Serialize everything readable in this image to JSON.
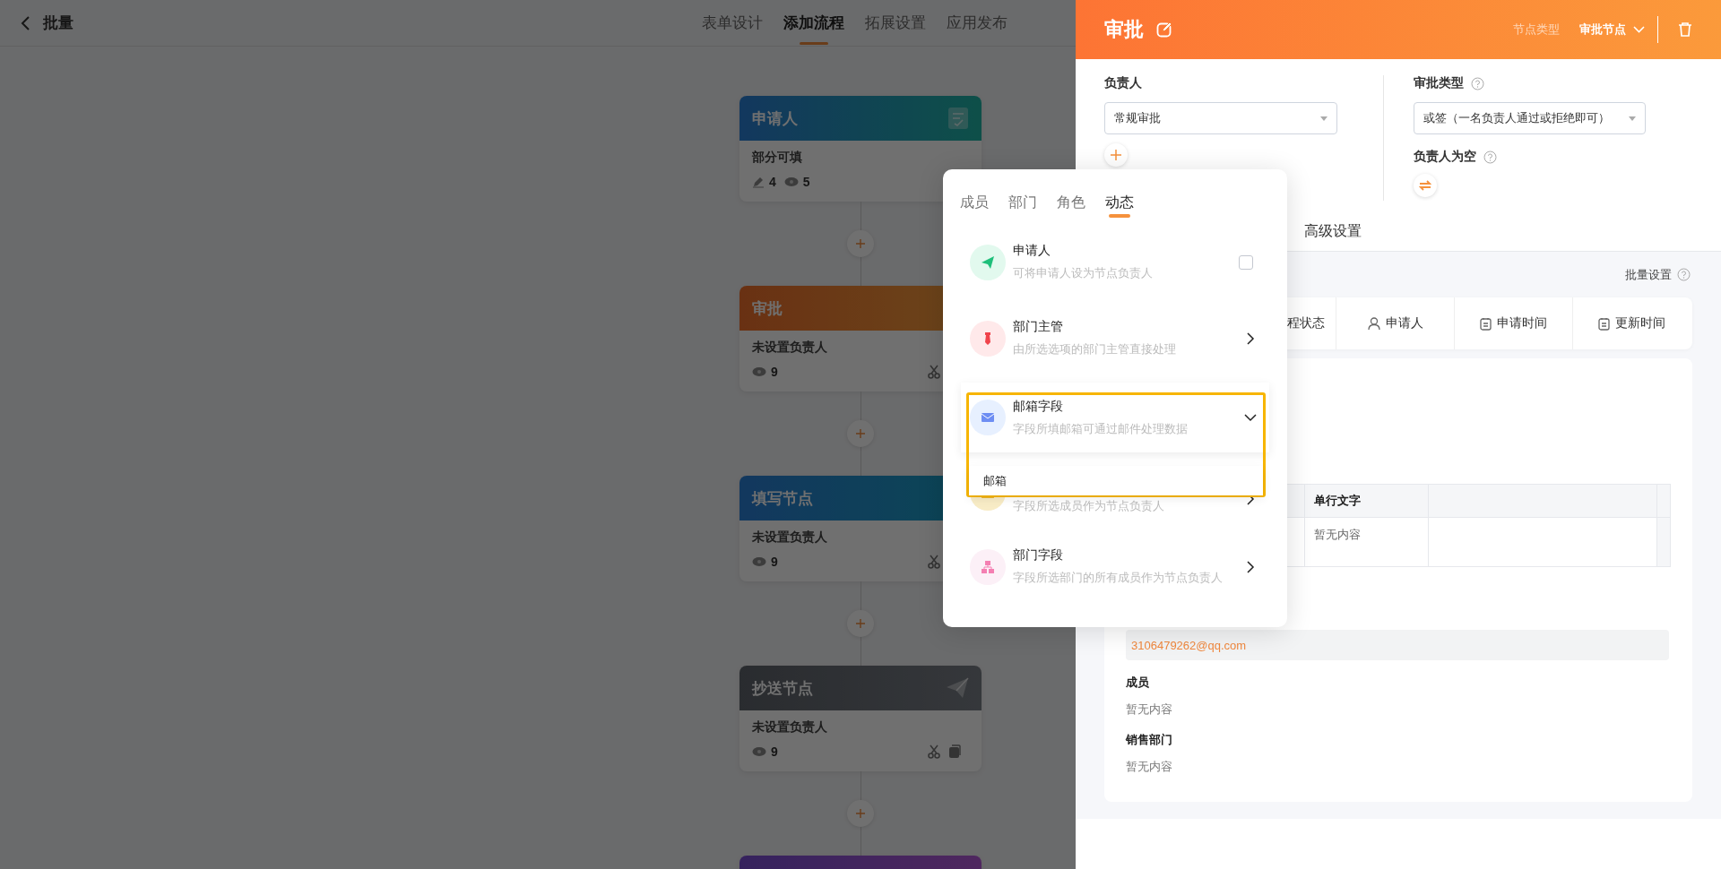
{
  "header": {
    "title": "批量",
    "tabs": [
      {
        "label": "表单设计",
        "selected": false
      },
      {
        "label": "添加流程",
        "selected": true
      },
      {
        "label": "拓展设置",
        "selected": false
      },
      {
        "label": "应用发布",
        "selected": false
      }
    ]
  },
  "flow": {
    "nodes": [
      {
        "kind": "start",
        "title": "申请人",
        "summary": "部分可填",
        "stats": [
          {
            "kind": "edit",
            "count": "4"
          },
          {
            "kind": "view",
            "count": "5"
          }
        ]
      },
      {
        "kind": "approval",
        "title": "审批",
        "summary": "未设置负责人",
        "stats": [
          {
            "kind": "view",
            "count": "9"
          }
        ],
        "actions": [
          {
            "kind": "cut"
          }
        ]
      },
      {
        "kind": "fill",
        "title": "填写节点",
        "summary": "未设置负责人",
        "stats": [
          {
            "kind": "view",
            "count": "9"
          }
        ],
        "actions": [
          {
            "kind": "cut"
          }
        ]
      },
      {
        "kind": "cc",
        "title": "抄送节点",
        "summary": "未设置负责人",
        "stats": [
          {
            "kind": "view",
            "count": "9"
          }
        ],
        "actions": [
          {
            "kind": "cut"
          },
          {
            "kind": "copy"
          }
        ]
      },
      {
        "kind": "other"
      }
    ]
  },
  "panel": {
    "title": "审批",
    "node_type_label": "节点类型",
    "node_type": "审批节点",
    "owner": {
      "label": "负责人",
      "value": "常规审批"
    },
    "approval_type": {
      "label": "审批类型",
      "value": "或签（一名负责人通过或拒绝即可）"
    },
    "empty_owner": {
      "label": "负责人为空"
    },
    "tabs": [
      {
        "label": "高级设置",
        "selected": false
      }
    ],
    "batch_label": "批量设置",
    "toolbar": [
      {
        "kind": "status",
        "label": "程状态"
      },
      {
        "kind": "person",
        "label": "申请人"
      },
      {
        "kind": "date",
        "label": "申请时间"
      },
      {
        "kind": "date",
        "label": "更新时间"
      }
    ],
    "table": {
      "columns": [
        "单行文字"
      ],
      "rows": [
        [
          "暂无内容"
        ]
      ]
    },
    "email": "3106479262@qq.com",
    "sections": [
      {
        "label": "成员",
        "value": "暂无内容"
      },
      {
        "label": "销售部门",
        "value": "暂无内容"
      }
    ]
  },
  "picker": {
    "tabs": [
      {
        "label": "成员",
        "selected": false
      },
      {
        "label": "部门",
        "selected": false
      },
      {
        "label": "角色",
        "selected": false
      },
      {
        "label": "动态",
        "selected": true
      }
    ],
    "items": [
      {
        "kind": "check",
        "title": "申请人",
        "desc": "可将申请人设为节点负责人",
        "checked": false
      },
      {
        "kind": "menu",
        "title": "部门主管",
        "desc": "由所选选项的部门主管直接处理",
        "expanded": false
      },
      {
        "kind": "menu",
        "title": "邮箱字段",
        "desc": "字段所填邮箱可通过邮件处理数据",
        "expanded": true,
        "options": [
          "邮箱"
        ]
      },
      {
        "kind": "menu",
        "desc": "字段所选成员作为节点负责人",
        "expanded": false
      },
      {
        "kind": "menu",
        "title": "部门字段",
        "desc": "字段所选部门的所有成员作为节点负责人",
        "expanded": false
      }
    ]
  }
}
